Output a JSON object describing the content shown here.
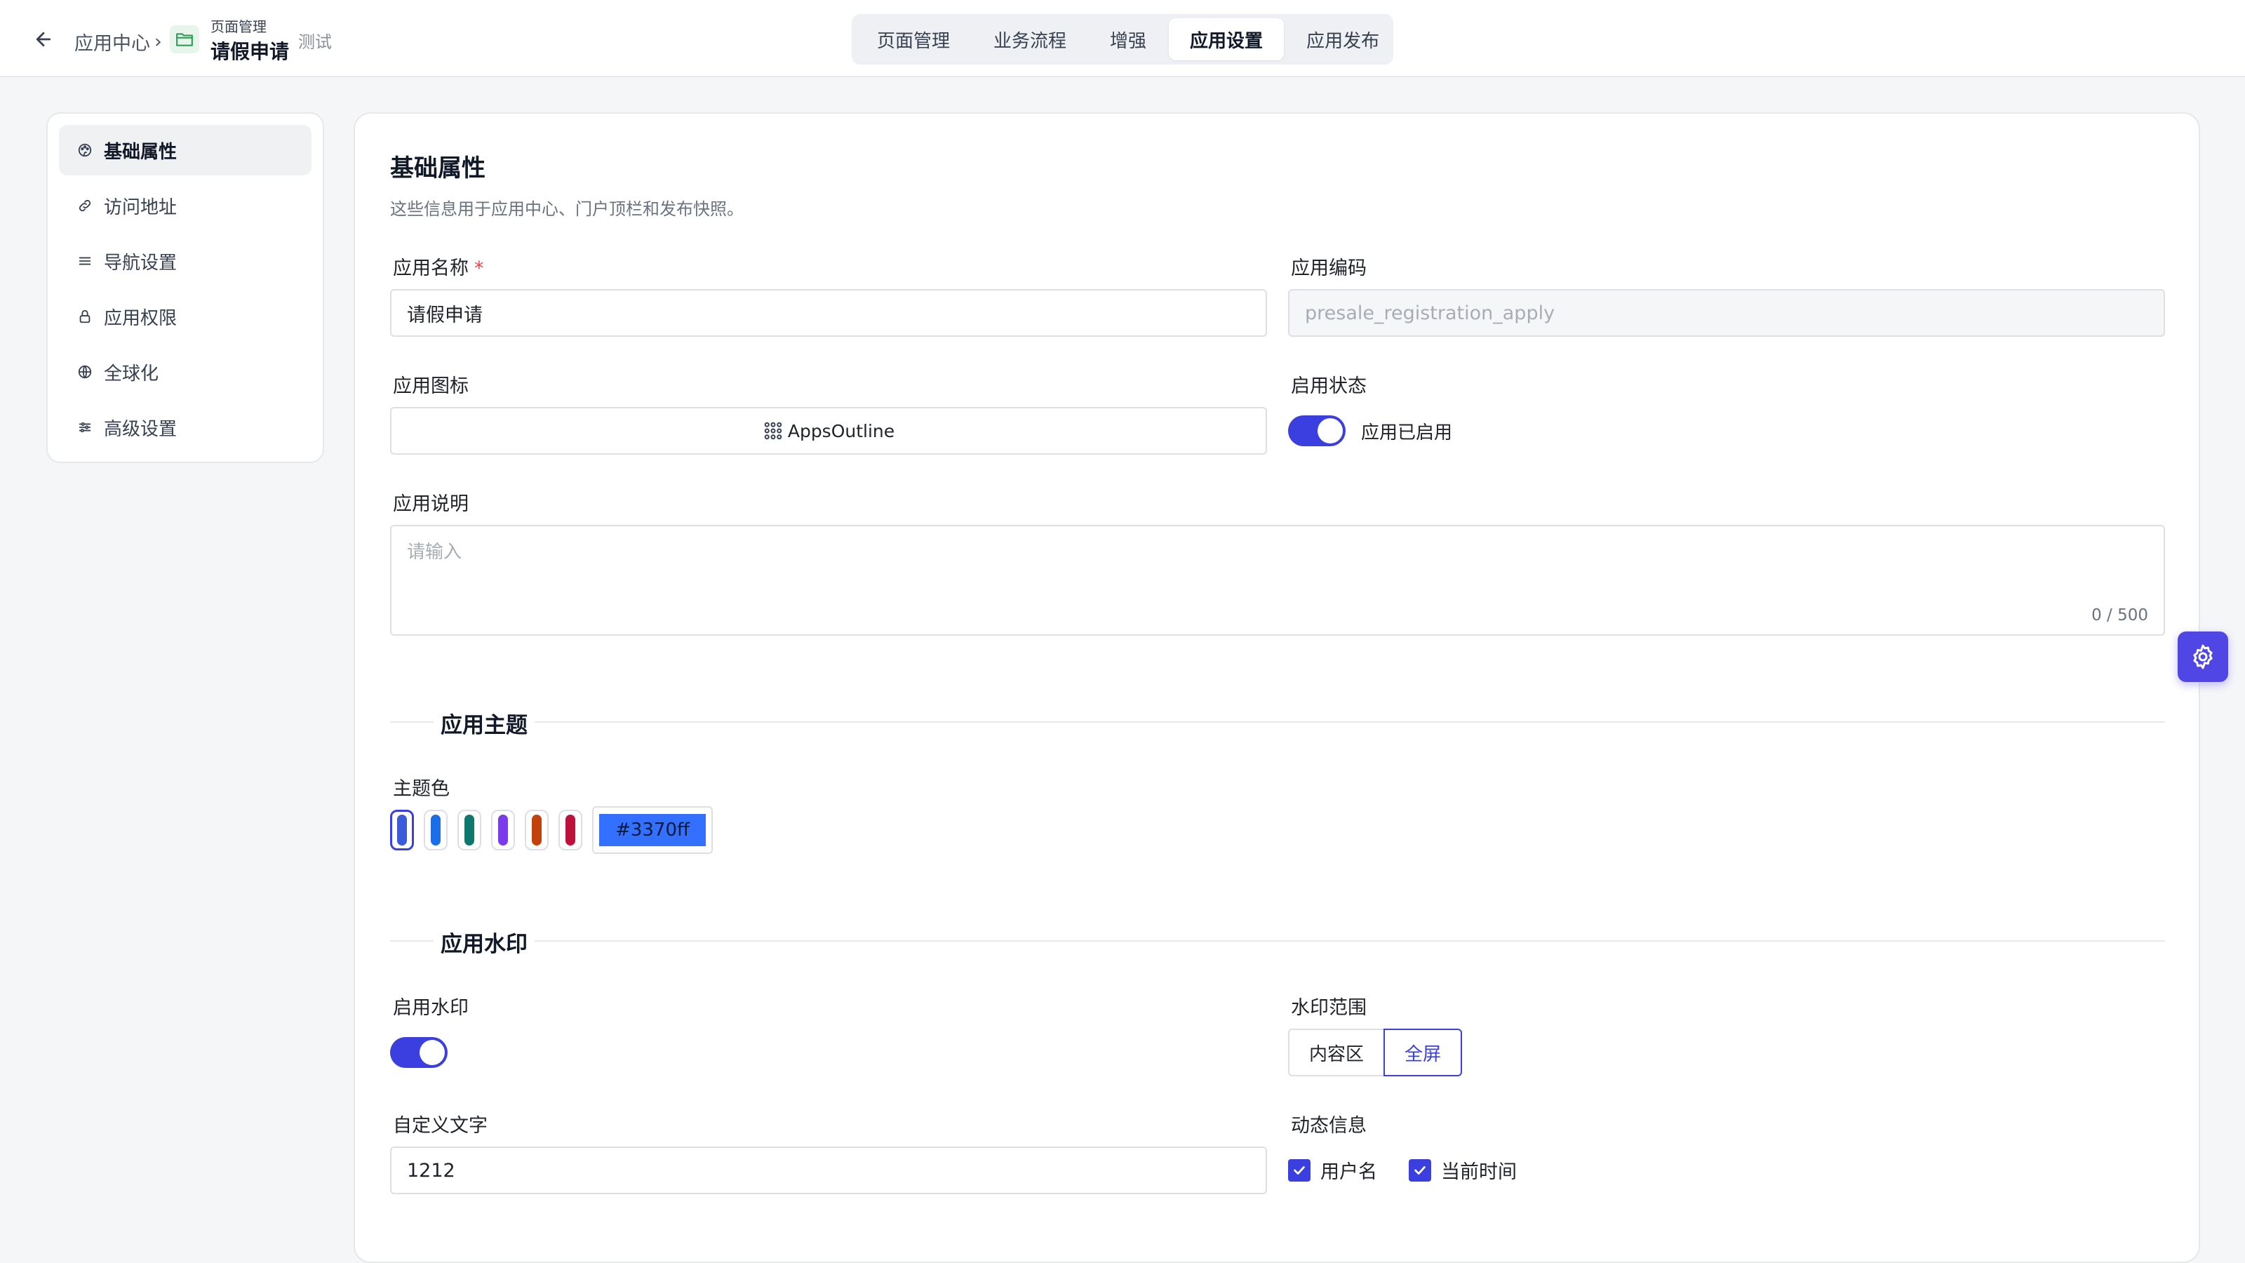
{
  "header": {
    "breadcrumb_root": "应用中心",
    "breadcrumb_separator": "›",
    "app_parent": "页面管理",
    "app_name": "请假申请",
    "env_tag": "测试"
  },
  "tabs": [
    {
      "label": "页面管理",
      "active": false
    },
    {
      "label": "业务流程",
      "active": false
    },
    {
      "label": "增强",
      "active": false
    },
    {
      "label": "应用设置",
      "active": true
    },
    {
      "label": "应用发布",
      "active": false
    }
  ],
  "sidebar": {
    "items": [
      {
        "label": "基础属性",
        "icon": "palette-icon",
        "active": true
      },
      {
        "label": "访问地址",
        "icon": "link-icon",
        "active": false
      },
      {
        "label": "导航设置",
        "icon": "menu-icon",
        "active": false
      },
      {
        "label": "应用权限",
        "icon": "lock-icon",
        "active": false
      },
      {
        "label": "全球化",
        "icon": "globe-icon",
        "active": false
      },
      {
        "label": "高级设置",
        "icon": "sliders-icon",
        "active": false
      }
    ]
  },
  "basic": {
    "title": "基础属性",
    "description": "这些信息用于应用中心、门户顶栏和发布快照。",
    "app_name_label": "应用名称",
    "required_mark": "*",
    "app_name_value": "请假申请",
    "app_code_label": "应用编码",
    "app_code_value": "presale_registration_apply",
    "app_icon_label": "应用图标",
    "app_icon_value": "AppsOutline",
    "status_label": "启用状态",
    "status_on": true,
    "status_text": "应用已启用",
    "desc_label": "应用说明",
    "desc_placeholder": "请输入",
    "desc_counter": "0 / 500"
  },
  "theme": {
    "section_title": "应用主题",
    "color_label": "主题色",
    "swatches": [
      "#3b5bdb",
      "#1c6ee8",
      "#0f766e",
      "#7c3aed",
      "#c2410c",
      "#be123c"
    ],
    "selected_index": 0,
    "hex_value": "#3370ff"
  },
  "watermark": {
    "section_title": "应用水印",
    "enable_label": "启用水印",
    "enabled": true,
    "scope_label": "水印范围",
    "scope_options": [
      "内容区",
      "全屏"
    ],
    "scope_selected": "全屏",
    "custom_text_label": "自定义文字",
    "custom_text_value": "1212",
    "dynamic_label": "动态信息",
    "dynamic_options": [
      {
        "label": "用户名",
        "checked": true
      },
      {
        "label": "当前时间",
        "checked": true
      }
    ]
  },
  "colors": {
    "accent": "#3b3fe0",
    "float_button": "#4f46e5"
  }
}
